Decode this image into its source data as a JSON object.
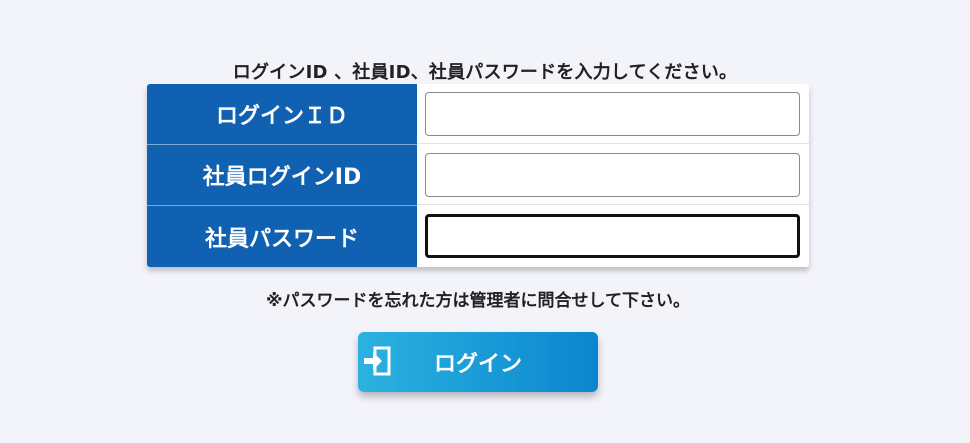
{
  "instruction": "ログインID 、社員ID、社員パスワードを入力してください。",
  "form": {
    "rows": [
      {
        "label": "ログインＩＤ",
        "value": ""
      },
      {
        "label": "社員ログインID",
        "value": ""
      },
      {
        "label": "社員パスワード",
        "value": ""
      }
    ]
  },
  "notice": "※パスワードを忘れた方は管理者に問合せして下さい。",
  "login_button": {
    "label": "ログイン",
    "icon": "login-icon"
  },
  "colors": {
    "label_bg": "#1161b2",
    "button_gradient_start": "#2cb2e0",
    "button_gradient_end": "#0a86cf",
    "page_bg": "#f3f4fa"
  }
}
